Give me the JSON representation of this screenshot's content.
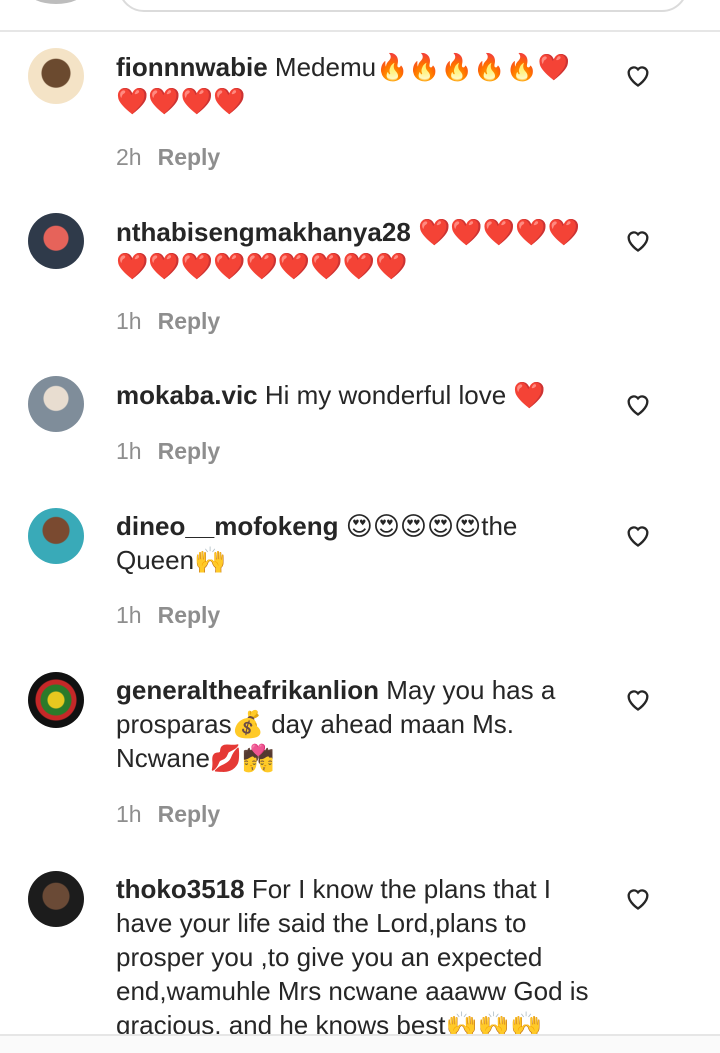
{
  "comments": [
    {
      "username": "fionnnwabie",
      "text": "Medemu🔥🔥🔥🔥🔥❤️❤️❤️❤️❤️",
      "time": "2h",
      "reply": "Reply",
      "avatar_color": "#f0d9b0"
    },
    {
      "username": "nthabisengmakhanya28",
      "text": "❤️❤️❤️❤️❤️❤️❤️❤️❤️❤️❤️❤️❤️❤️",
      "time": "1h",
      "reply": "Reply",
      "avatar_color": "#2f3a4a"
    },
    {
      "username": "mokaba.vic",
      "text": "Hi my wonderful love ❤️",
      "time": "1h",
      "reply": "Reply",
      "avatar_color": "#9aa9b8"
    },
    {
      "username": "dineo__mofokeng",
      "text": "😍😍😍😍😍the Queen🙌",
      "time": "1h",
      "reply": "Reply",
      "avatar_color": "#3aa7b5"
    },
    {
      "username": "generaltheafrikanlion",
      "text": "May you has a prosparas💰 day ahead maan Ms. Ncwane💋💏",
      "time": "1h",
      "reply": "Reply",
      "avatar_color": "#111111"
    },
    {
      "username": "thoko3518",
      "text": "For I know the plans that I have your life said the Lord,plans to prosper you ,to give you an expected end,wamuhle Mrs ncwane aaaww God is gracious, and he knows best🙌🙌🙌",
      "time": "",
      "reply": "",
      "avatar_color": "#1c1c1c"
    }
  ],
  "icons": {
    "like": "heart-outline-icon"
  },
  "colors": {
    "text": "#262626",
    "muted": "#8e8e8e",
    "divider": "#e6e6e6"
  }
}
